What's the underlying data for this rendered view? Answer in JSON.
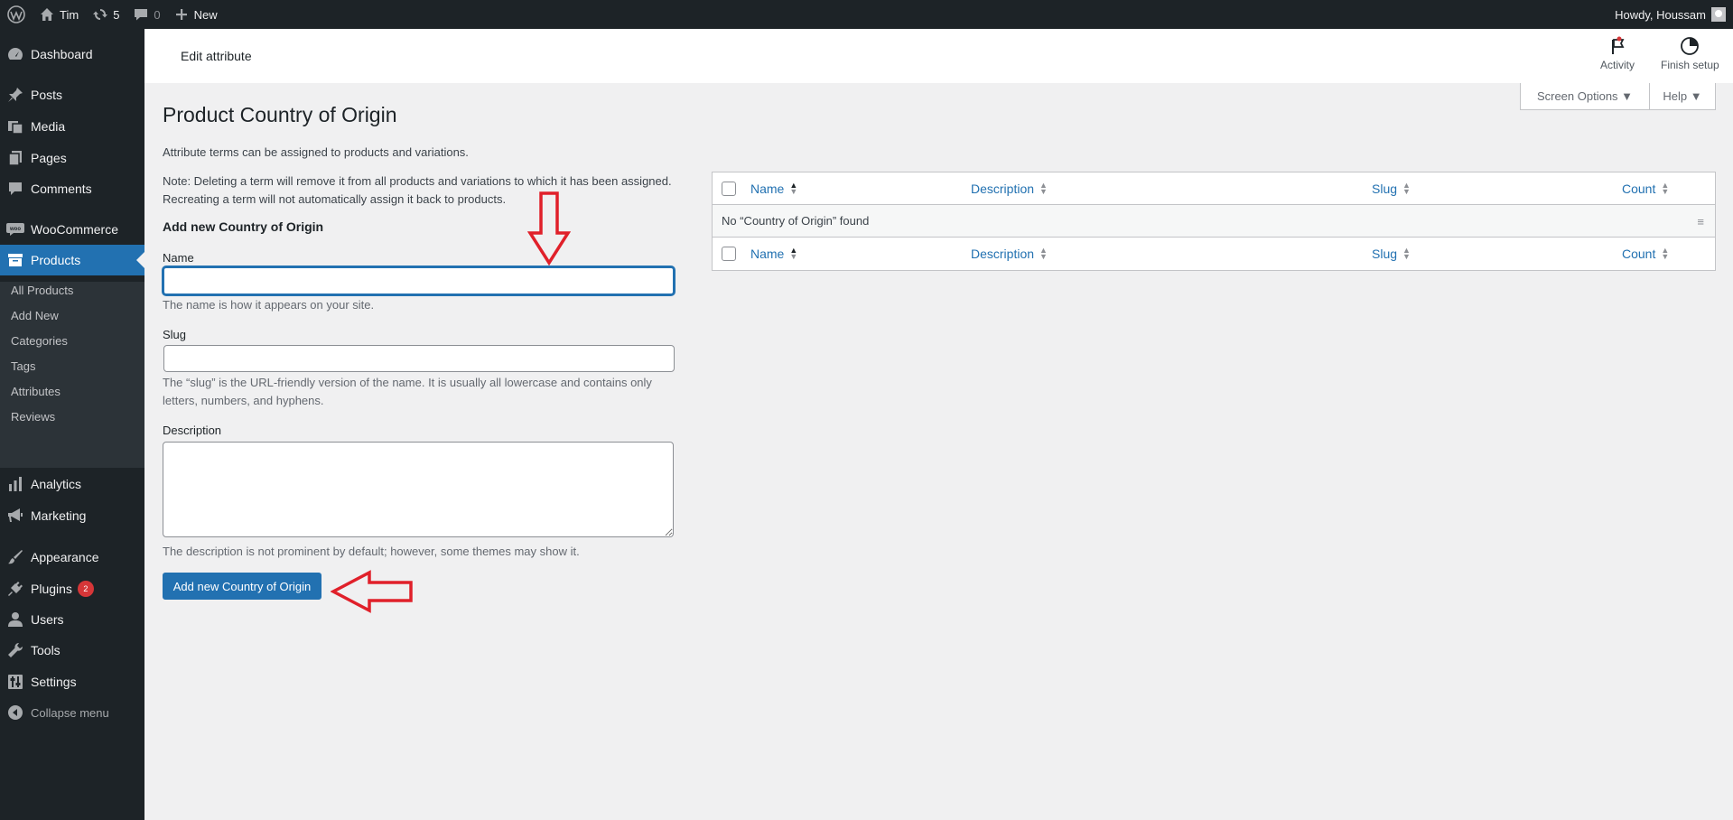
{
  "admin_bar": {
    "site_name": "Tim",
    "updates_count": "5",
    "comments_count": "0",
    "new_label": "New",
    "greeting": "Howdy, Houssam"
  },
  "sidebar": {
    "items": [
      {
        "label": "Dashboard",
        "icon": "dashboard-icon"
      },
      {
        "label": "Posts",
        "icon": "pin-icon"
      },
      {
        "label": "Media",
        "icon": "media-icon"
      },
      {
        "label": "Pages",
        "icon": "pages-icon"
      },
      {
        "label": "Comments",
        "icon": "comment-icon"
      },
      {
        "label": "WooCommerce",
        "icon": "woo-icon"
      },
      {
        "label": "Products",
        "icon": "archive-icon"
      },
      {
        "label": "Analytics",
        "icon": "bar-chart-icon"
      },
      {
        "label": "Marketing",
        "icon": "megaphone-icon"
      },
      {
        "label": "Appearance",
        "icon": "brush-icon"
      },
      {
        "label": "Plugins",
        "icon": "plug-icon",
        "badge": "2"
      },
      {
        "label": "Users",
        "icon": "user-icon"
      },
      {
        "label": "Tools",
        "icon": "wrench-icon"
      },
      {
        "label": "Settings",
        "icon": "sliders-icon"
      }
    ],
    "submenu": [
      "All Products",
      "Add New",
      "Categories",
      "Tags",
      "Attributes",
      "Reviews"
    ],
    "collapse_label": "Collapse menu"
  },
  "header": {
    "title": "Edit attribute",
    "activity_label": "Activity",
    "finish_setup_label": "Finish setup"
  },
  "screen_options_label": "Screen Options ▼",
  "help_label": "Help ▼",
  "page": {
    "title": "Product Country of Origin",
    "intro": "Attribute terms can be assigned to products and variations.",
    "note_line1": "Note: Deleting a term will remove it from all products and variations to which it has been assigned.",
    "note_line2": "Recreating a term will not automatically assign it back to products."
  },
  "form": {
    "heading": "Add new Country of Origin",
    "name_label": "Name",
    "name_value": "",
    "name_hint": "The name is how it appears on your site.",
    "slug_label": "Slug",
    "slug_value": "",
    "slug_hint_line1": "The “slug” is the URL-friendly version of the name. It is usually all lowercase and contains only",
    "slug_hint_line2": "letters, numbers, and hyphens.",
    "description_label": "Description",
    "description_value": "",
    "description_hint": "The description is not prominent by default; however, some themes may show it.",
    "submit_label": "Add new Country of Origin"
  },
  "table": {
    "columns": [
      "Name",
      "Description",
      "Slug",
      "Count"
    ],
    "empty_message": "No “Country of Origin” found"
  },
  "annotations": {
    "arrow_color": "#e0202a"
  }
}
